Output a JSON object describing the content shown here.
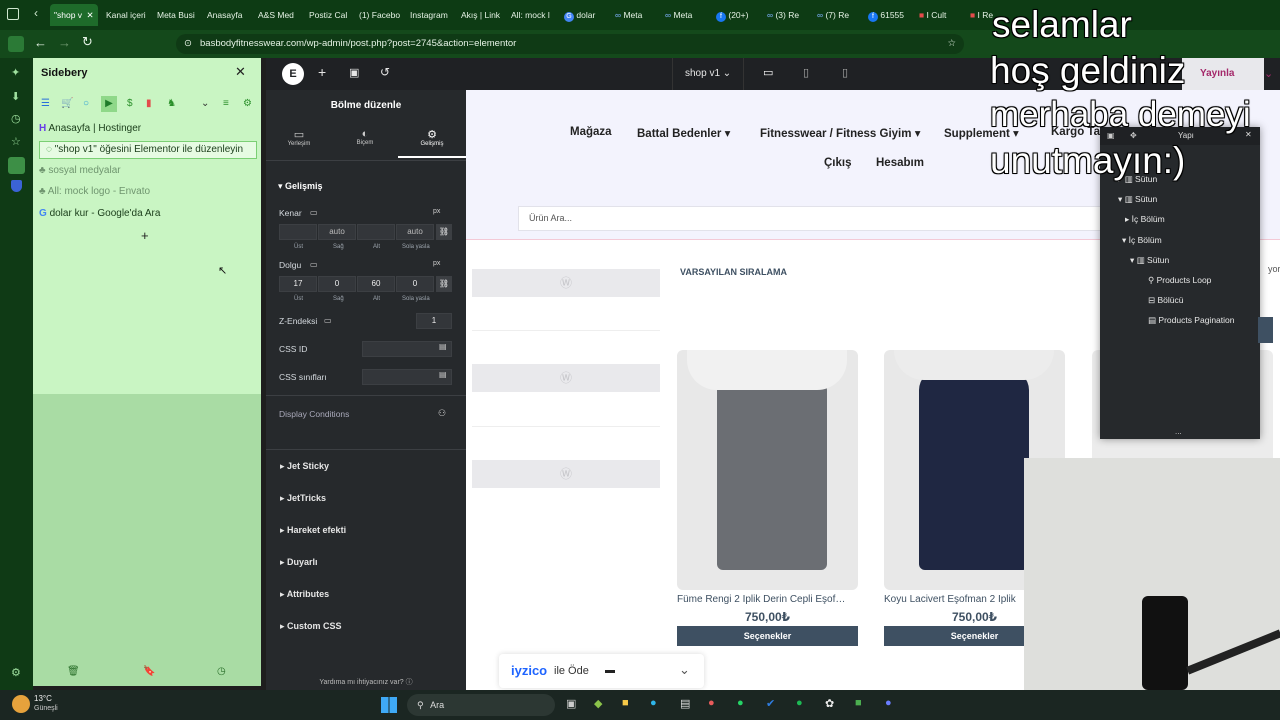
{
  "tabs": [
    {
      "label": "\"shop v"
    },
    {
      "label": "Kanal içeri"
    },
    {
      "label": "Meta Busi"
    },
    {
      "label": "Anasayfa"
    },
    {
      "label": "A&S Med"
    },
    {
      "label": "Postiz Cal"
    },
    {
      "label": "(1) Facebo"
    },
    {
      "label": "Instagram"
    },
    {
      "label": "Akış | Link"
    },
    {
      "label": "All: mock l"
    },
    {
      "label": "dolar"
    },
    {
      "label": "Meta"
    },
    {
      "label": "Meta"
    },
    {
      "label": "(20+)"
    },
    {
      "label": "(3) Re"
    },
    {
      "label": "(7) Re"
    },
    {
      "label": "61555"
    },
    {
      "label": "I Cult"
    },
    {
      "label": "I Re"
    }
  ],
  "address": {
    "url": "basbodyfitnesswear.com/wp-admin/post.php?post=2745&action=elementor"
  },
  "sidebery": {
    "title": "Sidebery",
    "items": [
      {
        "label": "Anasayfa | Hostinger"
      },
      {
        "label": "\"shop v1\" öğesini Elementor ile düzenleyin"
      },
      {
        "label": "sosyal medyalar"
      },
      {
        "label": "All: mock logo - Envato"
      },
      {
        "label": "dolar kur - Google'da Ara"
      }
    ],
    "add": "+"
  },
  "elementor": {
    "panel_title": "Bölme düzenle",
    "tabs": [
      "Yerleşim",
      "Biçem",
      "Gelişmiş"
    ],
    "section": "Gelişmiş",
    "margin_label": "Kenar",
    "unit": "px",
    "margin_values": [
      "",
      "auto",
      "",
      "auto"
    ],
    "padding_label": "Dolgu",
    "padding_values": [
      "17",
      "0",
      "60",
      "0"
    ],
    "sides": [
      "Üst",
      "Sağ",
      "Alt",
      "Sola yasla"
    ],
    "zindex_label": "Z-Endeksi",
    "zindex_value": "1",
    "css_id": "CSS ID",
    "css_classes": "CSS sınıfları",
    "display_conditions": "Display Conditions",
    "accordions": [
      "Jet Sticky",
      "JetTricks",
      "Hareket efekti",
      "Duyarlı",
      "Attributes",
      "Custom CSS"
    ],
    "help": "Yardıma mı ihtiyacınız var?",
    "template": "shop v1",
    "publish": "Yayınla"
  },
  "site": {
    "nav": [
      "Mağaza",
      "Battal Bedenler",
      "Fitnesswear / Fitness Giyim",
      "Supplement",
      "Kargo Tak",
      "Çıkış",
      "Hesabım"
    ],
    "search_placeholder": "Ürün Ara...",
    "sort_label": "VARSAYILAN SIRALAMA",
    "side_text": "yor",
    "products": [
      {
        "title": "Füme Rengi 2 İplik Derin Cepli Eşof…",
        "price": "750,00₺",
        "button": "Seçenekler",
        "color": "#6b6e73"
      },
      {
        "title": "Koyu Lacivert Eşofman 2 İplik",
        "price": "750,00₺",
        "button": "Seçenekler",
        "color": "#1f2742"
      }
    ],
    "iyzico": "iyzico",
    "iyzico_suffix": "ile Öde"
  },
  "structure": {
    "title": "Yapı",
    "items": [
      "Sütun",
      "Sütun",
      "İç Bölüm",
      "İç Bölüm",
      "Sütun",
      "Products Loop",
      "Bölücü",
      "Products Pagination"
    ],
    "more": "..."
  },
  "overlay": {
    "line1": "selamlar",
    "line2": "hoş geldiniz",
    "line3": "merhaba demeyi",
    "line4": "unutmayın:)"
  },
  "taskbar": {
    "temp": "13°C",
    "weather": "Güneşli",
    "search": "Ara"
  },
  "colors": {
    "sidebery_bg": "#c9f5c3",
    "browser_green": "#14491b",
    "elementor_dark": "#26292c",
    "product_button": "#3e5062"
  }
}
